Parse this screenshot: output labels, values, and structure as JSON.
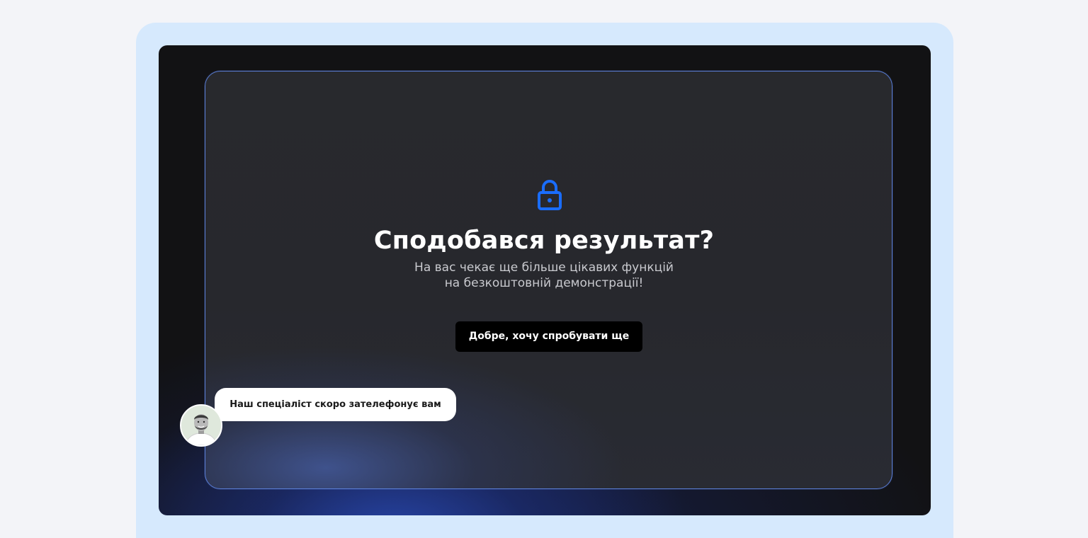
{
  "modal": {
    "icon": "lock-icon",
    "title": "Сподобався результат?",
    "subtitle_line1": "На вас чекає ще більше цікавих функцій",
    "subtitle_line2": "на безкоштовній демонстрації!",
    "cta_label": "Добре, хочу спробувати ще"
  },
  "chat": {
    "message": "Наш спеціаліст скоро зателефонує вам",
    "avatar": "specialist-avatar"
  },
  "colors": {
    "accent": "#1a6dff",
    "page_bg": "#f3f4f8",
    "frame_bg": "#d6e9fd",
    "screen_bg": "#121214",
    "modal_border": "#5b7fd8",
    "button_bg": "#000000"
  }
}
